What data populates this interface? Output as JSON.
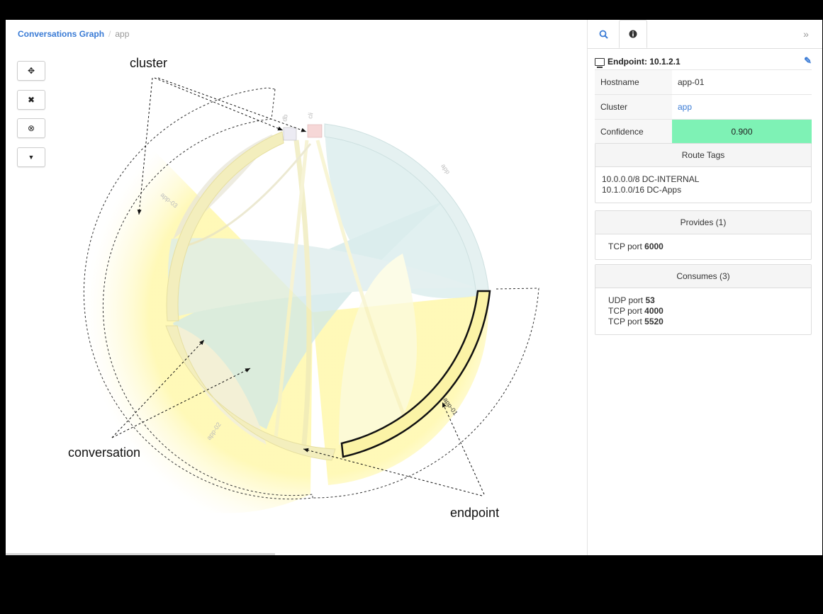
{
  "breadcrumb": {
    "root": "Conversations Graph",
    "current": "app"
  },
  "toolbar": {
    "buttons": [
      {
        "name": "move-tool-button",
        "icon": "move-icon",
        "glyph": "✥"
      },
      {
        "name": "clear-button",
        "icon": "close-icon",
        "glyph": "✖"
      },
      {
        "name": "remove-button",
        "icon": "circle-x-icon",
        "glyph": "⊗"
      },
      {
        "name": "filter-button",
        "icon": "filter-icon",
        "glyph": "▼"
      }
    ]
  },
  "graph": {
    "segments": [
      "app-01",
      "app-02",
      "app-03",
      "app",
      "db",
      "cli"
    ],
    "annotations": {
      "cluster": "cluster",
      "conversation": "conversation",
      "endpoint": "endpoint"
    }
  },
  "panel": {
    "tabs": {
      "search_icon": "search-icon",
      "info_icon": "info-icon",
      "collapse": "»"
    },
    "endpoint_title": "Endpoint: 10.1.2.1",
    "rows": [
      {
        "key": "Hostname",
        "value": "app-01"
      },
      {
        "key": "Cluster",
        "value": "app"
      },
      {
        "key": "Confidence",
        "value": "0.900"
      }
    ],
    "route_tags": {
      "title": "Route Tags",
      "items": [
        "10.0.0.0/8 DC-INTERNAL",
        "10.1.0.0/16 DC-Apps"
      ]
    },
    "provides": {
      "title": "Provides (1)",
      "items": [
        {
          "proto": "TCP port",
          "port": "6000"
        }
      ]
    },
    "consumes": {
      "title": "Consumes (3)",
      "items": [
        {
          "proto": "UDP port",
          "port": "53"
        },
        {
          "proto": "TCP port",
          "port": "4000"
        },
        {
          "proto": "TCP port",
          "port": "5520"
        }
      ]
    }
  },
  "colors": {
    "accent": "#3a7bd5",
    "confidence": "#7ef2b5",
    "cluster_glow": "#fff6a0",
    "teal_chord": "#c9e6e6"
  }
}
